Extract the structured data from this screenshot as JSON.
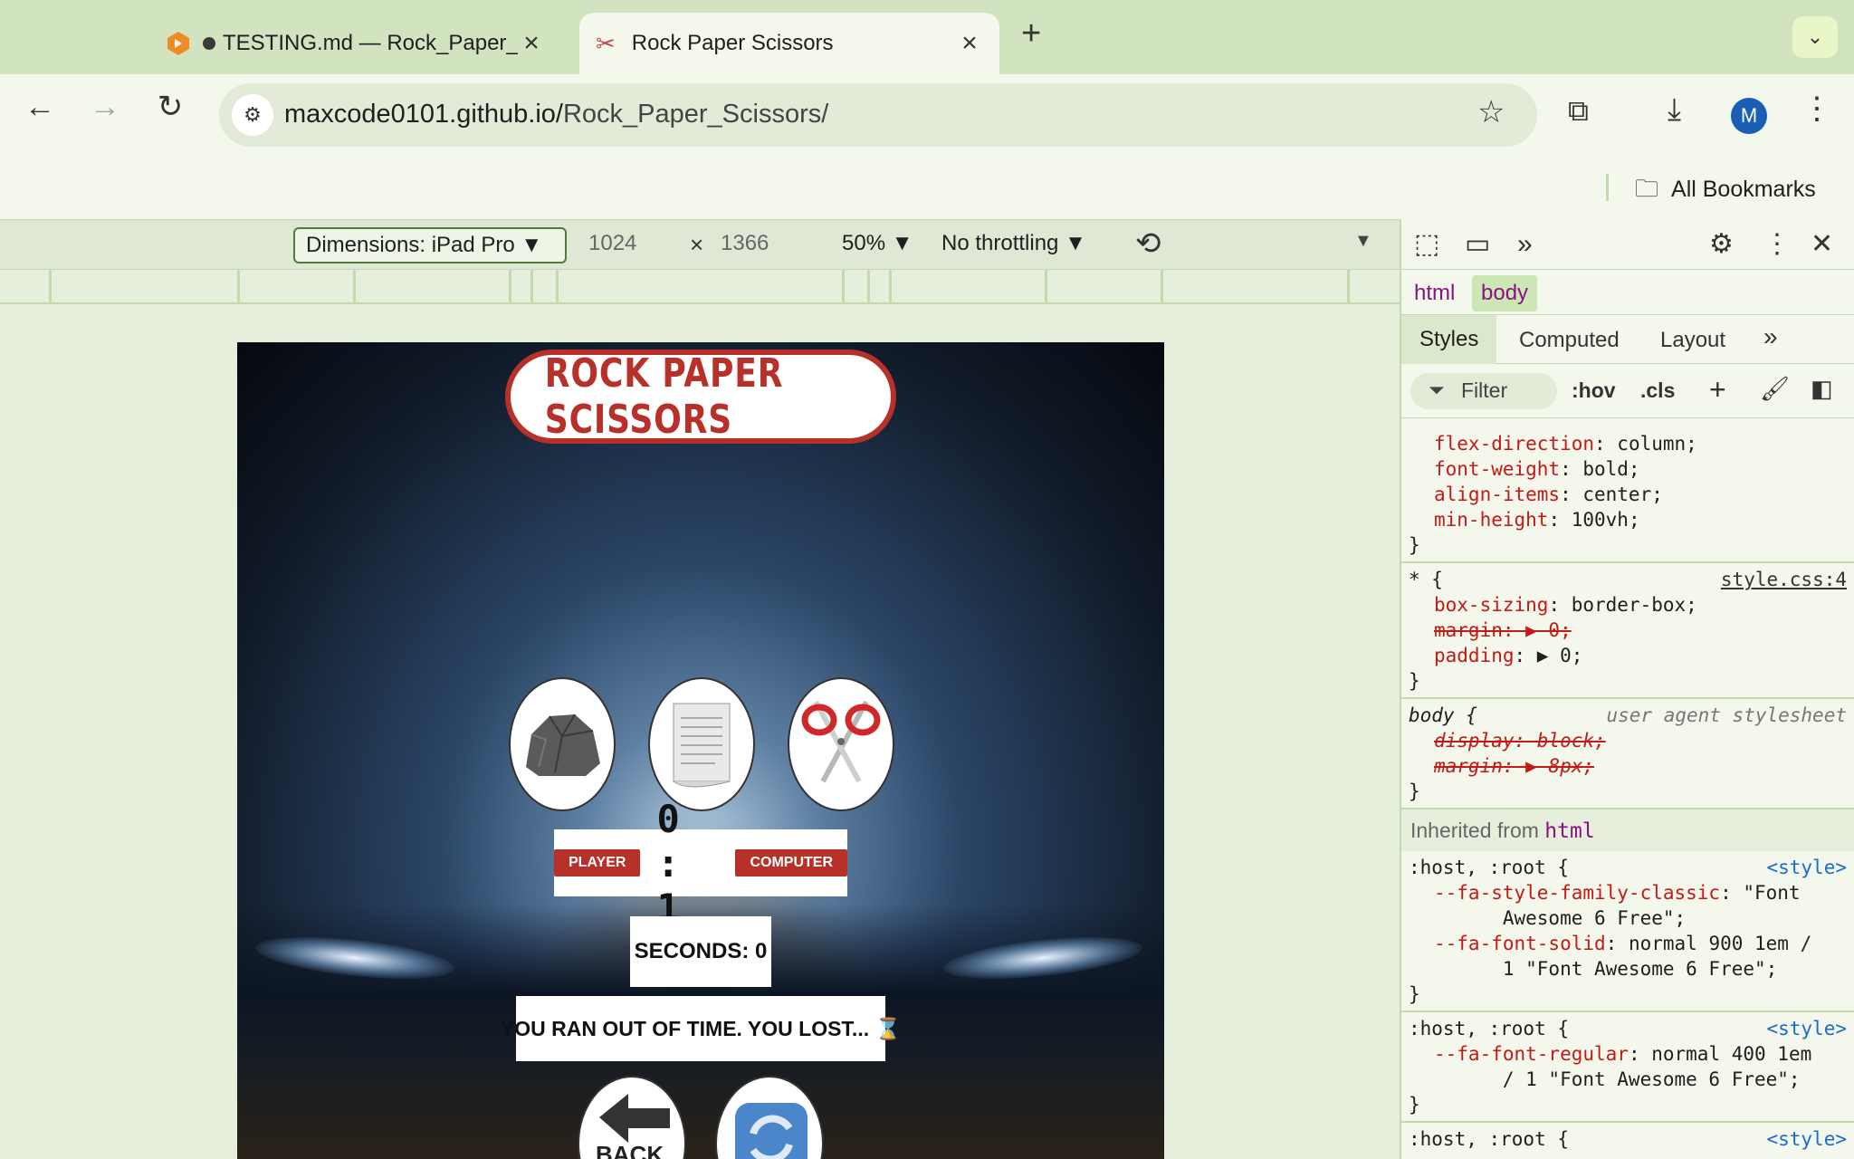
{
  "browser": {
    "tabs": [
      {
        "title": "TESTING.md — Rock_Paper_Scissors",
        "active": false
      },
      {
        "title": "Rock Paper Scissors",
        "active": true
      }
    ],
    "new_tab": "+",
    "url_host": "maxcode0101.github.io/",
    "url_path": "Rock_Paper_Scissors/",
    "profile_initial": "M",
    "bookmarks_label": "All Bookmarks"
  },
  "device_toolbar": {
    "dimensions_label": "Dimensions: iPad Pro ▼",
    "width": "1024",
    "times": "×",
    "height": "1366",
    "zoom": "50% ▼",
    "throttling": "No throttling ▼"
  },
  "game": {
    "title": "ROCK PAPER SCISSORS",
    "player_label": "PLAYER",
    "score": "0 : 1",
    "computer_label": "COMPUTER",
    "seconds_text": "SECONDS: 0",
    "message": "YOU RAN OUT OF TIME. YOU LOST... ⌛",
    "back_label": "BACK"
  },
  "devtools": {
    "crumbs": [
      "html",
      "body"
    ],
    "style_tabs": [
      "Styles",
      "Computed",
      "Layout"
    ],
    "filter_placeholder": "Filter",
    "hov": ":hov",
    "cls": ".cls",
    "inherited_label": "Inherited from",
    "inherited_from": "html",
    "rules": {
      "r0": {
        "l1p": "flex-direction",
        "l1v": ": column;",
        "l2p": "font-weight",
        "l2v": ": bold;",
        "l3p": "align-items",
        "l3v": ": center;",
        "l4p": "min-height",
        "l4v": ": 100vh;"
      },
      "r1": {
        "selector": "* {",
        "source": "style.css:4",
        "l1p": "box-sizing",
        "l1v": ": border-box;",
        "l2": "margin: ▶ 0;",
        "l3p": "padding",
        "l3v": ": ▶ 0;"
      },
      "r2": {
        "selector": "body {",
        "source": "user agent stylesheet",
        "l1": "display: block;",
        "l2": "margin: ▶ 8px;"
      },
      "r3": {
        "selector": ":host, :root {",
        "source": "<style>",
        "l1p": "--fa-style-family-classic",
        "l1v": ": \"Font",
        "l2": "      Awesome 6 Free\";",
        "l3p": "--fa-font-solid",
        "l3v": ": normal 900 1em /",
        "l4": "      1 \"Font Awesome 6 Free\";"
      },
      "r4": {
        "selector": ":host, :root {",
        "source": "<style>",
        "l1p": "--fa-font-regular",
        "l1v": ": normal 400 1em",
        "l2": "      / 1 \"Font Awesome 6 Free\";"
      },
      "r5": {
        "selector": ":host, :root {",
        "source": "<style>"
      }
    },
    "close_brace": "}"
  }
}
